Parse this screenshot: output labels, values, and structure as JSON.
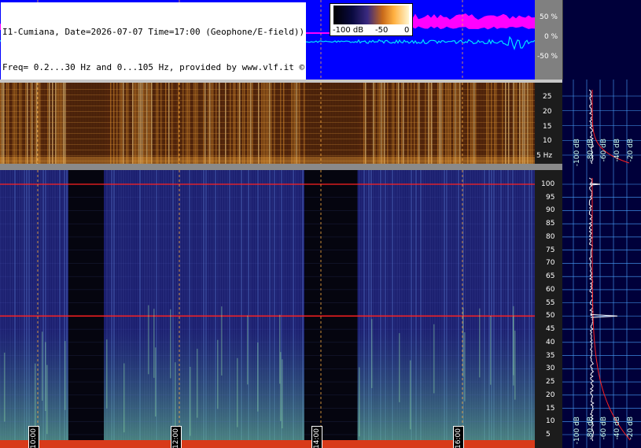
{
  "header": {
    "line1": "I1-Cumiana, Date=2026-07-07 Time=17:00 (Geophone/E-field))",
    "line2": "Freq= 0.2...30 Hz and 0...105 Hz, provided by www.vlf.it ©"
  },
  "colorbar": {
    "labels": [
      "-100 dB",
      "-50",
      "0"
    ]
  },
  "colors": {
    "waveform_bg": "#0000ff",
    "waveform_envelope": "#ff00ff",
    "waveform_trace": "#00e5ff",
    "spectro_low_bg": "#3b1a08",
    "spectro_high_bg": "#1a1e6e",
    "side_panel_bg": "#00003a",
    "grid": "#4aa3ff",
    "mains_line": "#ff2020",
    "time_marker": "#ffb040"
  },
  "chart_data": [
    {
      "type": "area",
      "panel": "waveform",
      "ylabel_ticks": [
        "50 %",
        "0 %",
        "-50 %"
      ],
      "ylim": [
        -100,
        100
      ]
    },
    {
      "type": "heatmap",
      "panel": "spectrogram-low",
      "freq_range_hz": [
        0.2,
        30
      ],
      "yticks": [
        "25",
        "20",
        "15",
        "10",
        "5 Hz"
      ],
      "ytick_values": [
        25,
        20,
        15,
        10,
        5
      ]
    },
    {
      "type": "heatmap",
      "panel": "spectrogram-high",
      "freq_range_hz": [
        0,
        105
      ],
      "yticks": [
        "100",
        "95",
        "90",
        "85",
        "80",
        "75",
        "70",
        "65",
        "60",
        "55",
        "50",
        "45",
        "40",
        "35",
        "30",
        "25",
        "20",
        "15",
        "10",
        "5"
      ],
      "ytick_values": [
        100,
        95,
        90,
        85,
        80,
        75,
        70,
        65,
        60,
        55,
        50,
        45,
        40,
        35,
        30,
        25,
        20,
        15,
        10,
        5
      ],
      "time_labels": [
        "10:00",
        "12:00",
        "14:00",
        "16:00"
      ],
      "dark_gaps": [
        [
          "10:30",
          "11:00"
        ],
        [
          "13:50",
          "14:35"
        ]
      ],
      "mains_hz": 50
    },
    {
      "type": "line",
      "panel": "spectrum-low",
      "db_axis": [
        "-100 dB",
        "-80 dB",
        "-60 dB",
        "-40 dB",
        "-20 dB"
      ]
    },
    {
      "type": "line",
      "panel": "spectrum-high",
      "db_axis": [
        "-100 dB",
        "-80 dB",
        "-60 dB",
        "-40 dB",
        "-20 dB"
      ]
    }
  ]
}
